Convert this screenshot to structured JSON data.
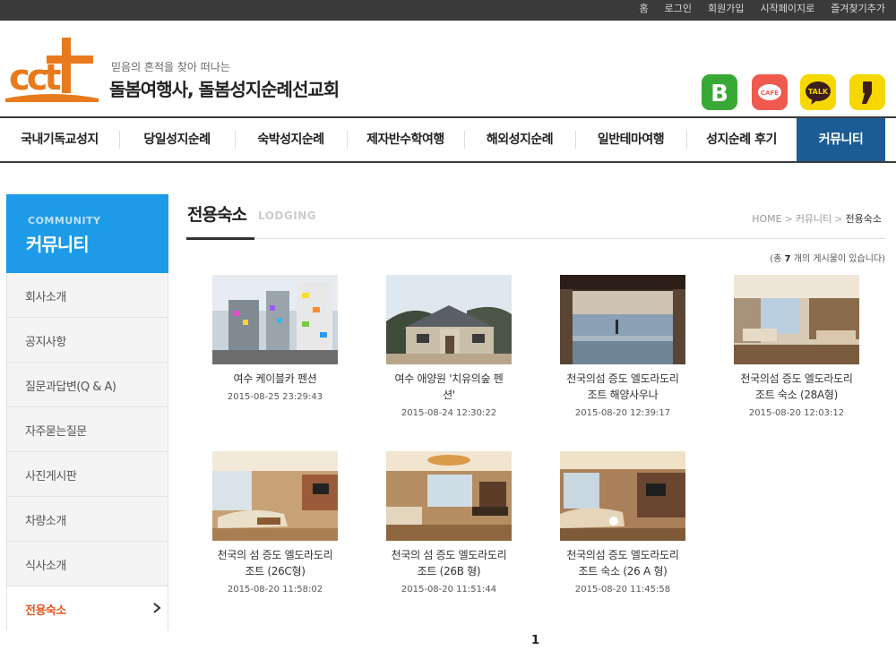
{
  "topbar": {
    "links": [
      "홈",
      "로그인",
      "회원가입",
      "시작페이지로",
      "즐겨찾기추가"
    ]
  },
  "header": {
    "logo_text": "cct",
    "tagline": "믿음의 흔적을 찾아 떠나는",
    "brand": "돌봄여행사, 돌봄성지순례선교회",
    "sns": [
      {
        "name": "blog",
        "label": "B",
        "color": "#39a935"
      },
      {
        "name": "cafe",
        "label": "CAFE",
        "color": "#ef5a4e"
      },
      {
        "name": "kakaotalk",
        "label": "TALK",
        "color": "#f6d800"
      },
      {
        "name": "kakaostory",
        "label": "",
        "color": "#f6d800"
      }
    ]
  },
  "gnb": {
    "items": [
      "국내기독교성지",
      "당일성지순례",
      "숙박성지순례",
      "제자반수학여행",
      "해외성지순례",
      "일반테마여행",
      "성지순례 후기",
      "커뮤니티"
    ],
    "active_index": 7,
    "active_color": "#1b5c95"
  },
  "sidebar": {
    "title_en": "COMMUNITY",
    "title": "커뮤니티",
    "head_color": "#1e9be8",
    "items": [
      "회사소개",
      "공지사항",
      "질문과답변(Q & A)",
      "자주묻는질문",
      "사진게시판",
      "차량소개",
      "식사소개",
      "전용숙소"
    ],
    "active_index": 7,
    "active_color": "#e8561e"
  },
  "content": {
    "title": "전용숙소",
    "title_en": "LODGING",
    "breadcrumb": [
      "HOME",
      "커뮤니티",
      "전용숙소"
    ],
    "count": {
      "prefix": "(총",
      "value": "7",
      "suffix": "개의 게시물이 있습니다)"
    },
    "posts": [
      {
        "title_lines": [
          "여수 케이블카 펜션"
        ],
        "date": "2015-08-25 23:29:43",
        "icon": "photo-building-thumbnail"
      },
      {
        "title_lines": [
          "여수 애양원 '치유의숲 펜",
          "션'"
        ],
        "date": "2015-08-24 12:30:22",
        "icon": "photo-house-thumbnail"
      },
      {
        "title_lines": [
          "천국의섬 증도 엘도라도리",
          "조트 해양사우나"
        ],
        "date": "2015-08-20 12:39:17",
        "icon": "photo-sauna-thumbnail"
      },
      {
        "title_lines": [
          "천국의섬 증도 엘도라도리",
          "조트 숙소 (28A형)"
        ],
        "date": "2015-08-20 12:03:12",
        "icon": "photo-room-thumbnail"
      },
      {
        "title_lines": [
          "천국의 섬 증도 엘도라도리",
          "조트 (26C형)"
        ],
        "date": "2015-08-20 11:58:02",
        "icon": "photo-room-thumbnail"
      },
      {
        "title_lines": [
          "천국의 섬 증도 엘도라도리",
          "조트 (26B 형)"
        ],
        "date": "2015-08-20 11:51:44",
        "icon": "photo-room-thumbnail"
      },
      {
        "title_lines": [
          "천국의섬 증도 엘도라도리",
          "조트 숙소 (26 A 형)"
        ],
        "date": "2015-08-20 11:45:58",
        "icon": "photo-room-thumbnail"
      }
    ],
    "pager": {
      "current": "1"
    }
  }
}
